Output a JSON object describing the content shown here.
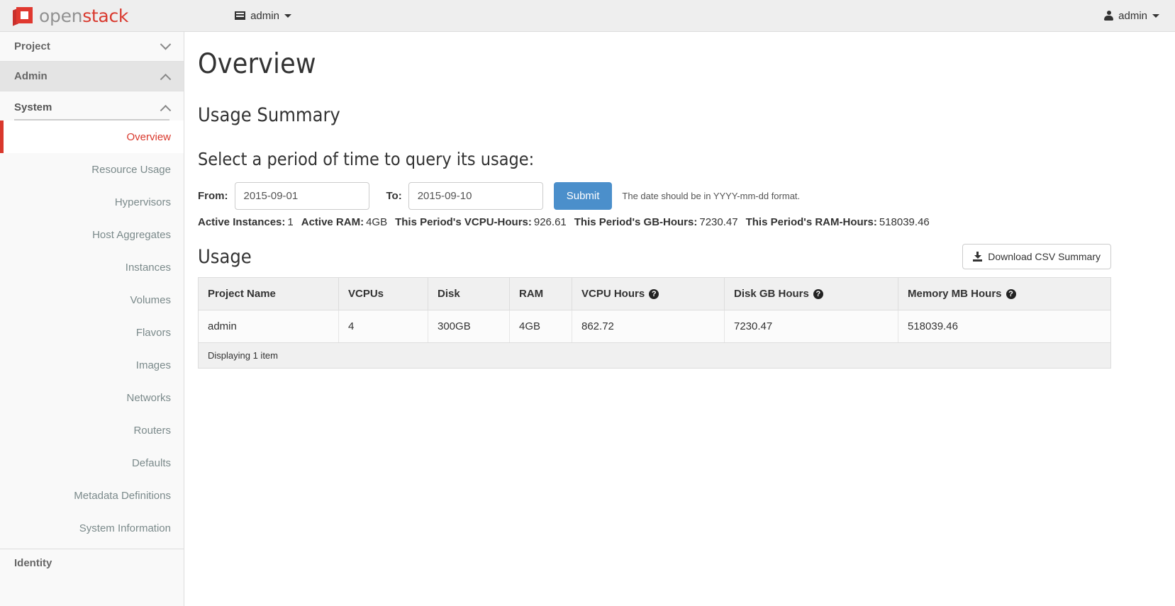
{
  "header": {
    "logo_text_1": "open",
    "logo_text_2": "stack",
    "context_label": "admin",
    "user_label": "admin"
  },
  "sidebar": {
    "groups": [
      {
        "label": "Project",
        "expanded": false
      },
      {
        "label": "Admin",
        "expanded": true
      }
    ],
    "subsection": {
      "label": "System",
      "expanded": true
    },
    "items": [
      {
        "label": "Overview",
        "active": true
      },
      {
        "label": "Resource Usage",
        "active": false
      },
      {
        "label": "Hypervisors",
        "active": false
      },
      {
        "label": "Host Aggregates",
        "active": false
      },
      {
        "label": "Instances",
        "active": false
      },
      {
        "label": "Volumes",
        "active": false
      },
      {
        "label": "Flavors",
        "active": false
      },
      {
        "label": "Images",
        "active": false
      },
      {
        "label": "Networks",
        "active": false
      },
      {
        "label": "Routers",
        "active": false
      },
      {
        "label": "Defaults",
        "active": false
      },
      {
        "label": "Metadata Definitions",
        "active": false
      },
      {
        "label": "System Information",
        "active": false
      }
    ],
    "bottom_group": {
      "label": "Identity"
    }
  },
  "main": {
    "page_title": "Overview",
    "section_title": "Usage Summary",
    "form_title": "Select a period of time to query its usage:",
    "form": {
      "from_label": "From:",
      "from_value": "2015-09-01",
      "to_label": "To:",
      "to_value": "2015-09-10",
      "submit_label": "Submit",
      "hint": "The date should be in YYYY-mm-dd format."
    },
    "stats": [
      {
        "key": "Active Instances:",
        "value": "1"
      },
      {
        "key": "Active RAM:",
        "value": "4GB"
      },
      {
        "key": "This Period's VCPU-Hours:",
        "value": "926.61"
      },
      {
        "key": "This Period's GB-Hours:",
        "value": "7230.47"
      },
      {
        "key": "This Period's RAM-Hours:",
        "value": "518039.46"
      }
    ],
    "usage_title": "Usage",
    "download_label": "Download CSV Summary",
    "table": {
      "columns": [
        {
          "label": "Project Name",
          "help": false
        },
        {
          "label": "VCPUs",
          "help": false
        },
        {
          "label": "Disk",
          "help": false
        },
        {
          "label": "RAM",
          "help": false
        },
        {
          "label": "VCPU Hours",
          "help": true
        },
        {
          "label": "Disk GB Hours",
          "help": true
        },
        {
          "label": "Memory MB Hours",
          "help": true
        }
      ],
      "rows": [
        {
          "project_name": "admin",
          "vcpus": "4",
          "disk": "300GB",
          "ram": "4GB",
          "vcpu_hours": "862.72",
          "disk_gb_hours": "7230.47",
          "memory_mb_hours": "518039.46"
        }
      ],
      "footer": "Displaying 1 item",
      "help_glyph": "?"
    }
  },
  "colors": {
    "brand_red": "#d9392e",
    "accent_blue": "#4b8fcb",
    "active_nav": "#d9382c"
  }
}
